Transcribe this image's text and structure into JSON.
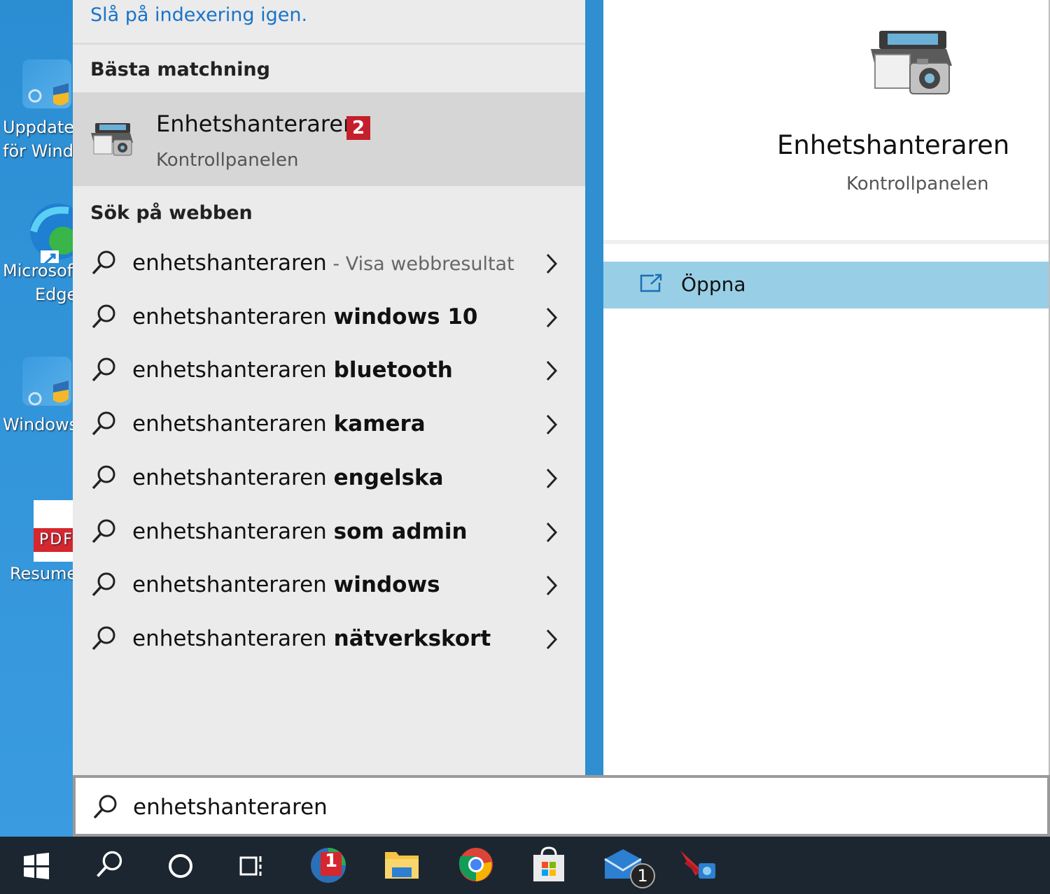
{
  "desktop": {
    "icons": [
      {
        "label1": "Uppdatera",
        "label2": "för Windows"
      },
      {
        "label1": "Microsoft",
        "label2": "Edge"
      },
      {
        "label1": "Windows",
        "label2": ""
      },
      {
        "label1": "Resume",
        "label2": ""
      }
    ],
    "pdf_text": "PDF"
  },
  "left": {
    "indexing_link": "Slå på indexering igen.",
    "best_match_title": "Bästa matchning",
    "best_match": {
      "name": "Enhetshanteraren",
      "badge": "2",
      "sub": "Kontrollpanelen"
    },
    "web_title": "Sök på webben",
    "web_results": [
      {
        "prefix": "enhetshanteraren",
        "bold": "",
        "hint": " - Visa webbresultat"
      },
      {
        "prefix": "enhetshanteraren ",
        "bold": "windows 10",
        "hint": ""
      },
      {
        "prefix": "enhetshanteraren ",
        "bold": "bluetooth",
        "hint": ""
      },
      {
        "prefix": "enhetshanteraren ",
        "bold": "kamera",
        "hint": ""
      },
      {
        "prefix": "enhetshanteraren ",
        "bold": "engelska",
        "hint": ""
      },
      {
        "prefix": "enhetshanteraren ",
        "bold": "som admin",
        "hint": ""
      },
      {
        "prefix": "enhetshanteraren ",
        "bold": "windows",
        "hint": ""
      },
      {
        "prefix": "enhetshanteraren ",
        "bold": "nätverkskort",
        "hint": ""
      }
    ]
  },
  "right": {
    "title": "Enhetshanteraren",
    "sub": "Kontrollpanelen",
    "open_label": "Öppna"
  },
  "search": {
    "value": "enhetshanteraren"
  },
  "taskbar": {
    "badge_red": "1",
    "badge_mail": "1"
  }
}
